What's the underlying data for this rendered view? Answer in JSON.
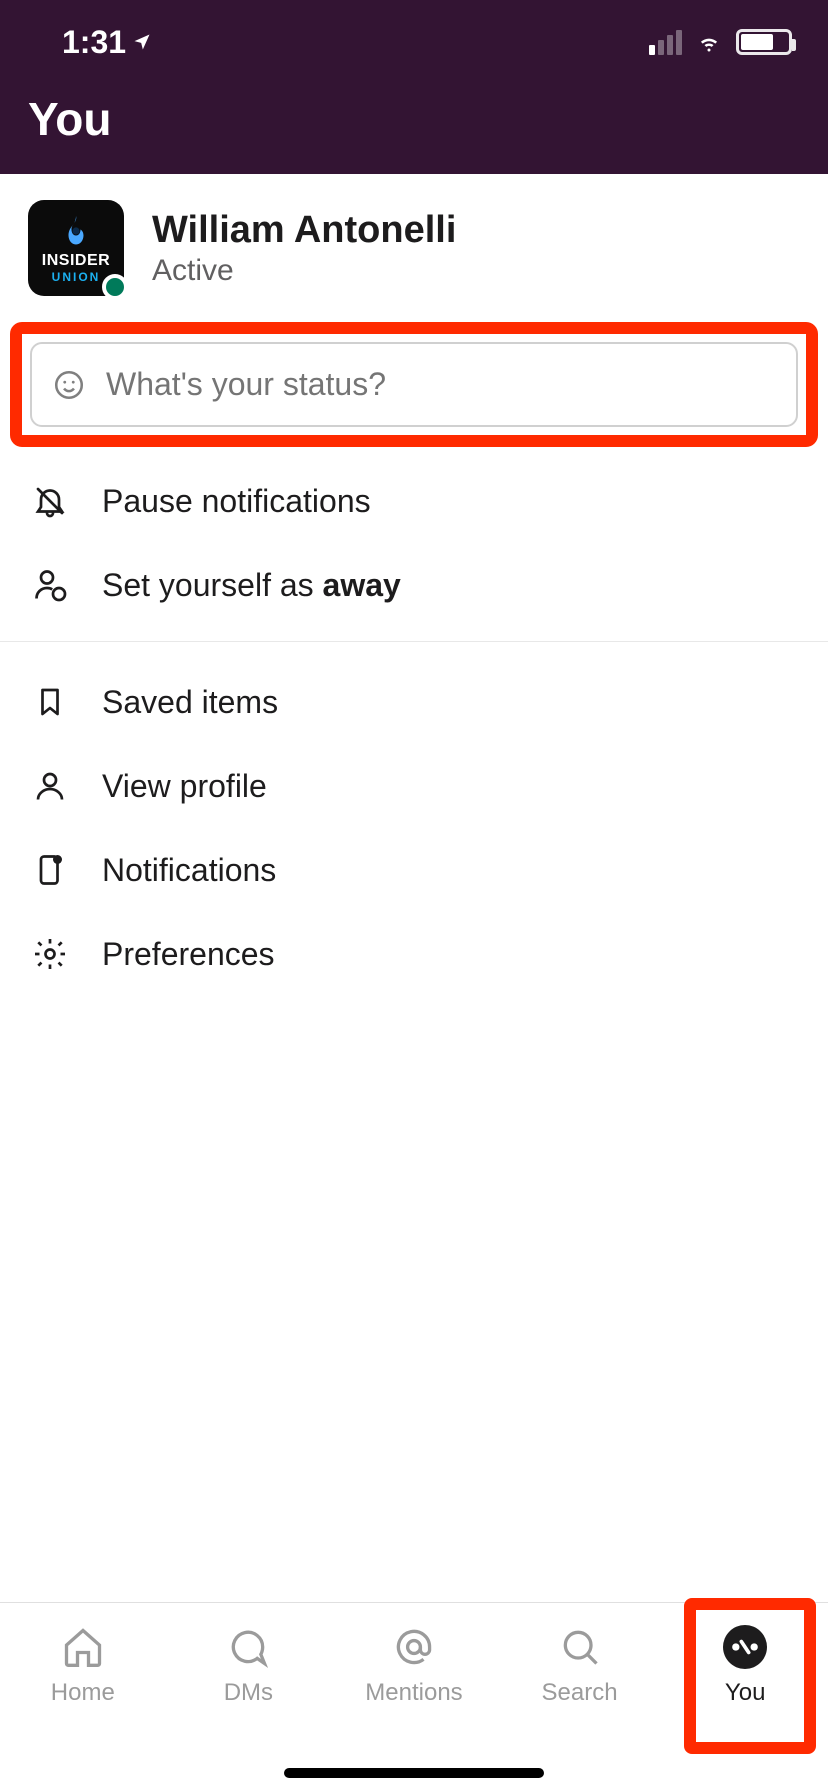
{
  "statusbar": {
    "time": "1:31"
  },
  "header": {
    "title": "You"
  },
  "profile": {
    "name": "William Antonelli",
    "presence": "Active",
    "avatar_text1": "INSIDER",
    "avatar_text2": "UNION"
  },
  "status_input": {
    "placeholder": "What's your status?"
  },
  "menu": {
    "pause_notifications": "Pause notifications",
    "set_away_prefix": "Set yourself as ",
    "set_away_bold": "away",
    "saved_items": "Saved items",
    "view_profile": "View profile",
    "notifications": "Notifications",
    "preferences": "Preferences"
  },
  "tabs": {
    "home": "Home",
    "dms": "DMs",
    "mentions": "Mentions",
    "search": "Search",
    "you": "You"
  }
}
